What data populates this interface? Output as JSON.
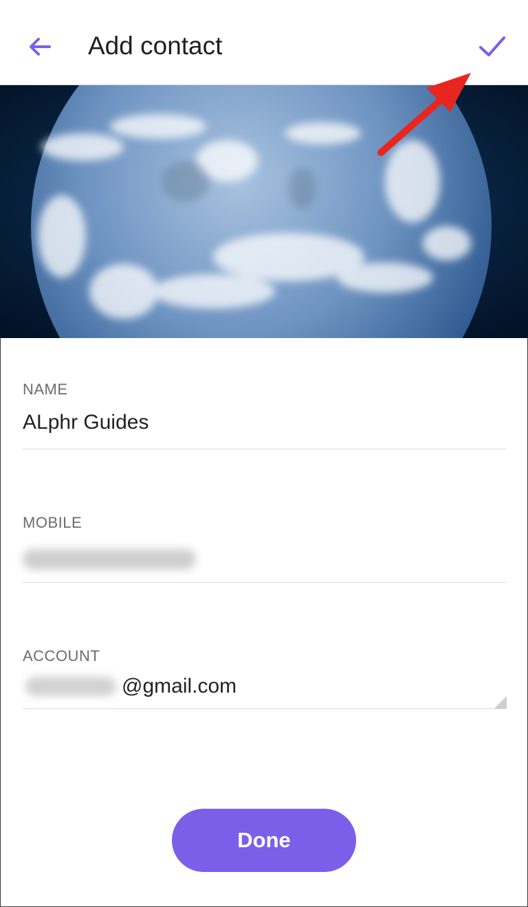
{
  "appbar": {
    "title": "Add contact",
    "back_icon": "arrow-left-icon",
    "confirm_icon": "check-icon",
    "accent_color": "#7b5fe9"
  },
  "cover": {
    "image": "earth-photo"
  },
  "annotation": {
    "arrow_color": "#e8261f"
  },
  "form": {
    "name": {
      "label": "NAME",
      "value": "ALphr Guides"
    },
    "mobile": {
      "label": "MOBILE"
    },
    "account": {
      "label": "ACCOUNT",
      "value_suffix": "@gmail.com"
    }
  },
  "done_button": {
    "label": "Done",
    "color": "#7b5fe9"
  }
}
